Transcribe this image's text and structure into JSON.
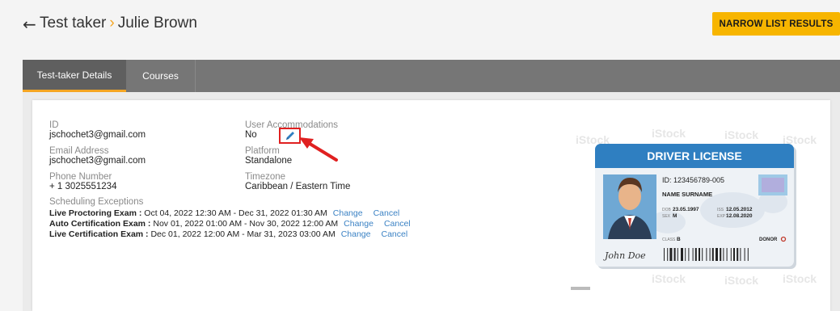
{
  "header": {
    "back_icon": "arrow-left-icon",
    "breadcrumb_root": "Test taker",
    "breadcrumb_separator": "›",
    "breadcrumb_current": "Julie Brown",
    "narrow_button": "NARROW LIST RESULTS"
  },
  "tabs": [
    {
      "label": "Test-taker Details",
      "active": true
    },
    {
      "label": "Courses",
      "active": false
    }
  ],
  "details": {
    "id_label": "ID",
    "id_value": "jschochet3@gmail.com",
    "email_label": "Email Address",
    "email_value": "jschochet3@gmail.com",
    "phone_label": "Phone Number",
    "phone_value": "+ 1  3025551234",
    "accommodations_label": "User Accommodations",
    "accommodations_value": "No",
    "platform_label": "Platform",
    "platform_value": "Standalone",
    "timezone_label": "Timezone",
    "timezone_value": "Caribbean / Eastern Time",
    "exceptions_label": "Scheduling Exceptions"
  },
  "exceptions": [
    {
      "name": "Live Proctoring Exam :",
      "range": " Oct 04, 2022 12:30 AM - Dec 31, 2022 01:30 AM",
      "change": "Change",
      "cancel": "Cancel"
    },
    {
      "name": "Auto Certification Exam :",
      "range": " Nov 01, 2022 01:00 AM - Nov 30, 2022 12:00 AM",
      "change": "Change",
      "cancel": "Cancel"
    },
    {
      "name": "Live Certification Exam :",
      "range": " Dec 01, 2022 12:00 AM - Mar 31, 2023 03:00 AM",
      "change": "Change",
      "cancel": "Cancel"
    }
  ],
  "license": {
    "title": "DRIVER LICENSE",
    "id_line": "ID: 123456789-005",
    "name": "NAME SURNAME",
    "dob_label": "DOB",
    "dob": "23.05.1997",
    "iss_label": "ISS",
    "iss": "12.05.2012",
    "sex_label": "SEX",
    "sex": "M",
    "exp_label": "EXP",
    "exp": "12.08.2020",
    "class_label": "CLASS",
    "class": "B",
    "donor": "DONOR",
    "signature": "John Doe",
    "watermark": "iStock"
  },
  "colors": {
    "accent": "#f7b500",
    "tabbar": "#767676",
    "link": "#3b82c4",
    "annotation": "#e02020",
    "license_blue": "#2f7fc1"
  }
}
